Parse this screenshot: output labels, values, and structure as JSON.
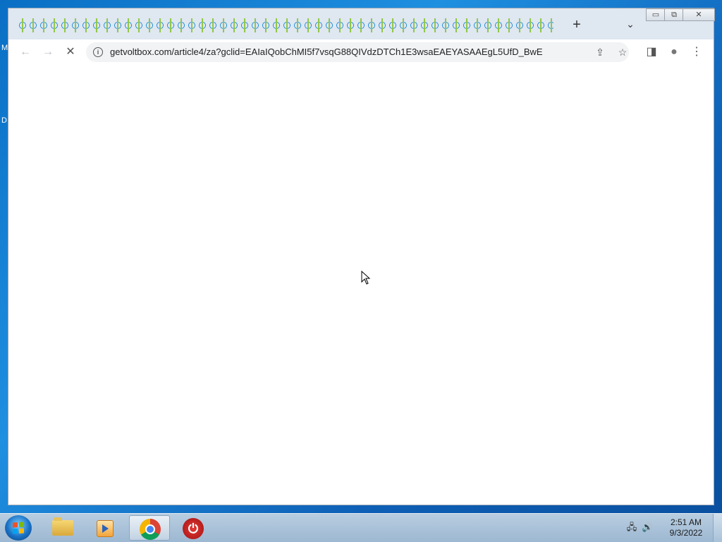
{
  "desktop": {
    "edge_glyph_1": "M",
    "edge_glyph_2": "D"
  },
  "browser": {
    "new_tab_symbol": "+",
    "tab_list_symbol": "⌄",
    "window_controls": {
      "minimize": "▭",
      "maximize": "⧉",
      "close": "✕"
    },
    "nav": {
      "back": "←",
      "forward": "→",
      "reload": "✕"
    },
    "address": {
      "url": "getvoltbox.com/article4/za?gclid=EAIaIQobChMI5f7vsqG88QIVdzDTCh1E3wsaEAEYASAAEgL5UfD_BwE",
      "info_symbol": "i"
    },
    "omnibox_actions": {
      "share": "⇪",
      "bookmark": "☆"
    },
    "toolbar_actions": {
      "side_panel": "◨",
      "profile": "●",
      "menu": "⋮"
    }
  },
  "taskbar": {
    "apps": [
      {
        "name": "file-explorer"
      },
      {
        "name": "media-player"
      },
      {
        "name": "chrome",
        "active": true
      },
      {
        "name": "power-app"
      }
    ],
    "tray": {
      "network": "🖧",
      "volume": "🔊"
    },
    "clock": {
      "time": "2:51 AM",
      "date": "9/3/2022"
    }
  }
}
